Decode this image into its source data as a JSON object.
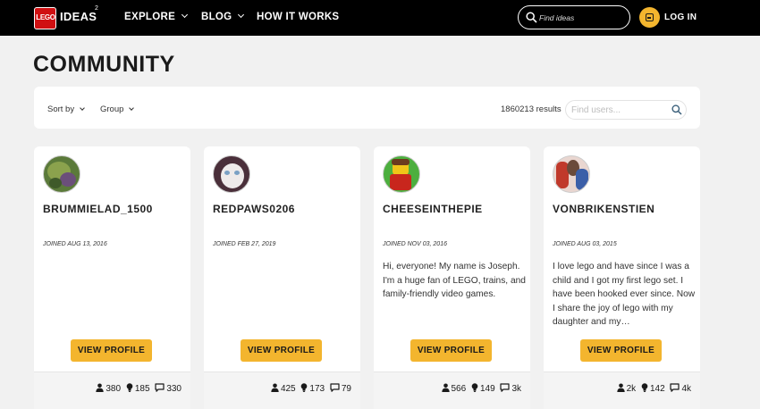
{
  "header": {
    "logo_mark": "LEGO",
    "logo_text": "IDEAS",
    "logo_sup": "2",
    "nav": [
      {
        "label": "EXPLORE"
      },
      {
        "label": "BLOG"
      },
      {
        "label": "HOW IT WORKS"
      }
    ],
    "search_placeholder": "Find ideas",
    "login_label": "LOG IN"
  },
  "page_title": "COMMUNITY",
  "filters": {
    "sort_label": "Sort by",
    "group_label": "Group",
    "results_text": "1860213 results",
    "search_placeholder": "Find users..."
  },
  "users": [
    {
      "username": "BRUMMIELAD_1500",
      "joined": "JOINED AUG 13, 2016",
      "bio": "",
      "button": "VIEW PROFILE",
      "stats": {
        "followers": "380",
        "ideas": "185",
        "comments": "330"
      }
    },
    {
      "username": "REDPAWS0206",
      "joined": "JOINED FEB 27, 2019",
      "bio": "",
      "button": "VIEW PROFILE",
      "stats": {
        "followers": "425",
        "ideas": "173",
        "comments": "79"
      }
    },
    {
      "username": "CHEESEINTHEPIE",
      "joined": "JOINED NOV 03, 2016",
      "bio": "Hi, everyone! My name is Joseph. I'm a huge fan of LEGO, trains, and family-friendly video games.",
      "button": "VIEW PROFILE",
      "stats": {
        "followers": "566",
        "ideas": "149",
        "comments": "3k"
      }
    },
    {
      "username": "VONBRIKENSTIEN",
      "joined": "JOINED AUG 03, 2015",
      "bio": "I love lego and have since I was a child and I got my first lego set. I have been hooked ever since. Now I share the joy of lego with my daughter and my…",
      "button": "VIEW PROFILE",
      "stats": {
        "followers": "2k",
        "ideas": "142",
        "comments": "4k"
      }
    }
  ],
  "colors": {
    "topbar": "#000000",
    "accent": "#f3b52e",
    "brand_red": "#d01012",
    "background": "#f1f1f1"
  }
}
